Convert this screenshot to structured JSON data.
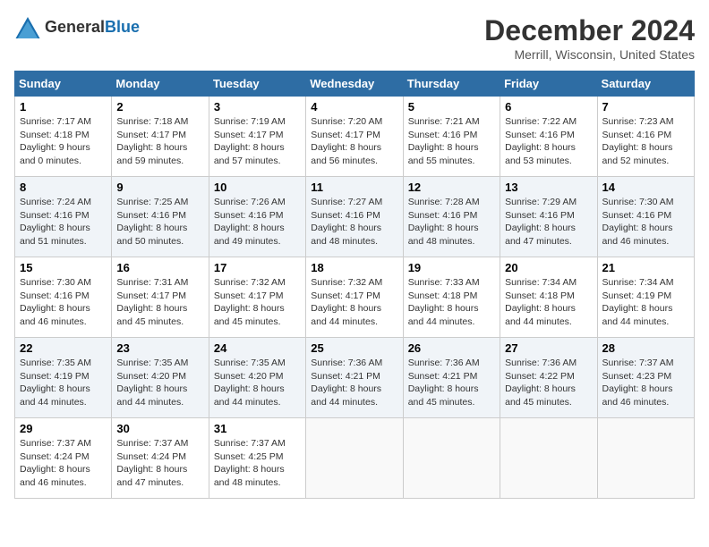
{
  "header": {
    "logo_general": "General",
    "logo_blue": "Blue",
    "month_title": "December 2024",
    "location": "Merrill, Wisconsin, United States"
  },
  "days_of_week": [
    "Sunday",
    "Monday",
    "Tuesday",
    "Wednesday",
    "Thursday",
    "Friday",
    "Saturday"
  ],
  "weeks": [
    [
      {
        "day": "1",
        "sunrise": "Sunrise: 7:17 AM",
        "sunset": "Sunset: 4:18 PM",
        "daylight": "Daylight: 9 hours and 0 minutes."
      },
      {
        "day": "2",
        "sunrise": "Sunrise: 7:18 AM",
        "sunset": "Sunset: 4:17 PM",
        "daylight": "Daylight: 8 hours and 59 minutes."
      },
      {
        "day": "3",
        "sunrise": "Sunrise: 7:19 AM",
        "sunset": "Sunset: 4:17 PM",
        "daylight": "Daylight: 8 hours and 57 minutes."
      },
      {
        "day": "4",
        "sunrise": "Sunrise: 7:20 AM",
        "sunset": "Sunset: 4:17 PM",
        "daylight": "Daylight: 8 hours and 56 minutes."
      },
      {
        "day": "5",
        "sunrise": "Sunrise: 7:21 AM",
        "sunset": "Sunset: 4:16 PM",
        "daylight": "Daylight: 8 hours and 55 minutes."
      },
      {
        "day": "6",
        "sunrise": "Sunrise: 7:22 AM",
        "sunset": "Sunset: 4:16 PM",
        "daylight": "Daylight: 8 hours and 53 minutes."
      },
      {
        "day": "7",
        "sunrise": "Sunrise: 7:23 AM",
        "sunset": "Sunset: 4:16 PM",
        "daylight": "Daylight: 8 hours and 52 minutes."
      }
    ],
    [
      {
        "day": "8",
        "sunrise": "Sunrise: 7:24 AM",
        "sunset": "Sunset: 4:16 PM",
        "daylight": "Daylight: 8 hours and 51 minutes."
      },
      {
        "day": "9",
        "sunrise": "Sunrise: 7:25 AM",
        "sunset": "Sunset: 4:16 PM",
        "daylight": "Daylight: 8 hours and 50 minutes."
      },
      {
        "day": "10",
        "sunrise": "Sunrise: 7:26 AM",
        "sunset": "Sunset: 4:16 PM",
        "daylight": "Daylight: 8 hours and 49 minutes."
      },
      {
        "day": "11",
        "sunrise": "Sunrise: 7:27 AM",
        "sunset": "Sunset: 4:16 PM",
        "daylight": "Daylight: 8 hours and 48 minutes."
      },
      {
        "day": "12",
        "sunrise": "Sunrise: 7:28 AM",
        "sunset": "Sunset: 4:16 PM",
        "daylight": "Daylight: 8 hours and 48 minutes."
      },
      {
        "day": "13",
        "sunrise": "Sunrise: 7:29 AM",
        "sunset": "Sunset: 4:16 PM",
        "daylight": "Daylight: 8 hours and 47 minutes."
      },
      {
        "day": "14",
        "sunrise": "Sunrise: 7:30 AM",
        "sunset": "Sunset: 4:16 PM",
        "daylight": "Daylight: 8 hours and 46 minutes."
      }
    ],
    [
      {
        "day": "15",
        "sunrise": "Sunrise: 7:30 AM",
        "sunset": "Sunset: 4:16 PM",
        "daylight": "Daylight: 8 hours and 46 minutes."
      },
      {
        "day": "16",
        "sunrise": "Sunrise: 7:31 AM",
        "sunset": "Sunset: 4:17 PM",
        "daylight": "Daylight: 8 hours and 45 minutes."
      },
      {
        "day": "17",
        "sunrise": "Sunrise: 7:32 AM",
        "sunset": "Sunset: 4:17 PM",
        "daylight": "Daylight: 8 hours and 45 minutes."
      },
      {
        "day": "18",
        "sunrise": "Sunrise: 7:32 AM",
        "sunset": "Sunset: 4:17 PM",
        "daylight": "Daylight: 8 hours and 44 minutes."
      },
      {
        "day": "19",
        "sunrise": "Sunrise: 7:33 AM",
        "sunset": "Sunset: 4:18 PM",
        "daylight": "Daylight: 8 hours and 44 minutes."
      },
      {
        "day": "20",
        "sunrise": "Sunrise: 7:34 AM",
        "sunset": "Sunset: 4:18 PM",
        "daylight": "Daylight: 8 hours and 44 minutes."
      },
      {
        "day": "21",
        "sunrise": "Sunrise: 7:34 AM",
        "sunset": "Sunset: 4:19 PM",
        "daylight": "Daylight: 8 hours and 44 minutes."
      }
    ],
    [
      {
        "day": "22",
        "sunrise": "Sunrise: 7:35 AM",
        "sunset": "Sunset: 4:19 PM",
        "daylight": "Daylight: 8 hours and 44 minutes."
      },
      {
        "day": "23",
        "sunrise": "Sunrise: 7:35 AM",
        "sunset": "Sunset: 4:20 PM",
        "daylight": "Daylight: 8 hours and 44 minutes."
      },
      {
        "day": "24",
        "sunrise": "Sunrise: 7:35 AM",
        "sunset": "Sunset: 4:20 PM",
        "daylight": "Daylight: 8 hours and 44 minutes."
      },
      {
        "day": "25",
        "sunrise": "Sunrise: 7:36 AM",
        "sunset": "Sunset: 4:21 PM",
        "daylight": "Daylight: 8 hours and 44 minutes."
      },
      {
        "day": "26",
        "sunrise": "Sunrise: 7:36 AM",
        "sunset": "Sunset: 4:21 PM",
        "daylight": "Daylight: 8 hours and 45 minutes."
      },
      {
        "day": "27",
        "sunrise": "Sunrise: 7:36 AM",
        "sunset": "Sunset: 4:22 PM",
        "daylight": "Daylight: 8 hours and 45 minutes."
      },
      {
        "day": "28",
        "sunrise": "Sunrise: 7:37 AM",
        "sunset": "Sunset: 4:23 PM",
        "daylight": "Daylight: 8 hours and 46 minutes."
      }
    ],
    [
      {
        "day": "29",
        "sunrise": "Sunrise: 7:37 AM",
        "sunset": "Sunset: 4:24 PM",
        "daylight": "Daylight: 8 hours and 46 minutes."
      },
      {
        "day": "30",
        "sunrise": "Sunrise: 7:37 AM",
        "sunset": "Sunset: 4:24 PM",
        "daylight": "Daylight: 8 hours and 47 minutes."
      },
      {
        "day": "31",
        "sunrise": "Sunrise: 7:37 AM",
        "sunset": "Sunset: 4:25 PM",
        "daylight": "Daylight: 8 hours and 48 minutes."
      },
      null,
      null,
      null,
      null
    ]
  ]
}
